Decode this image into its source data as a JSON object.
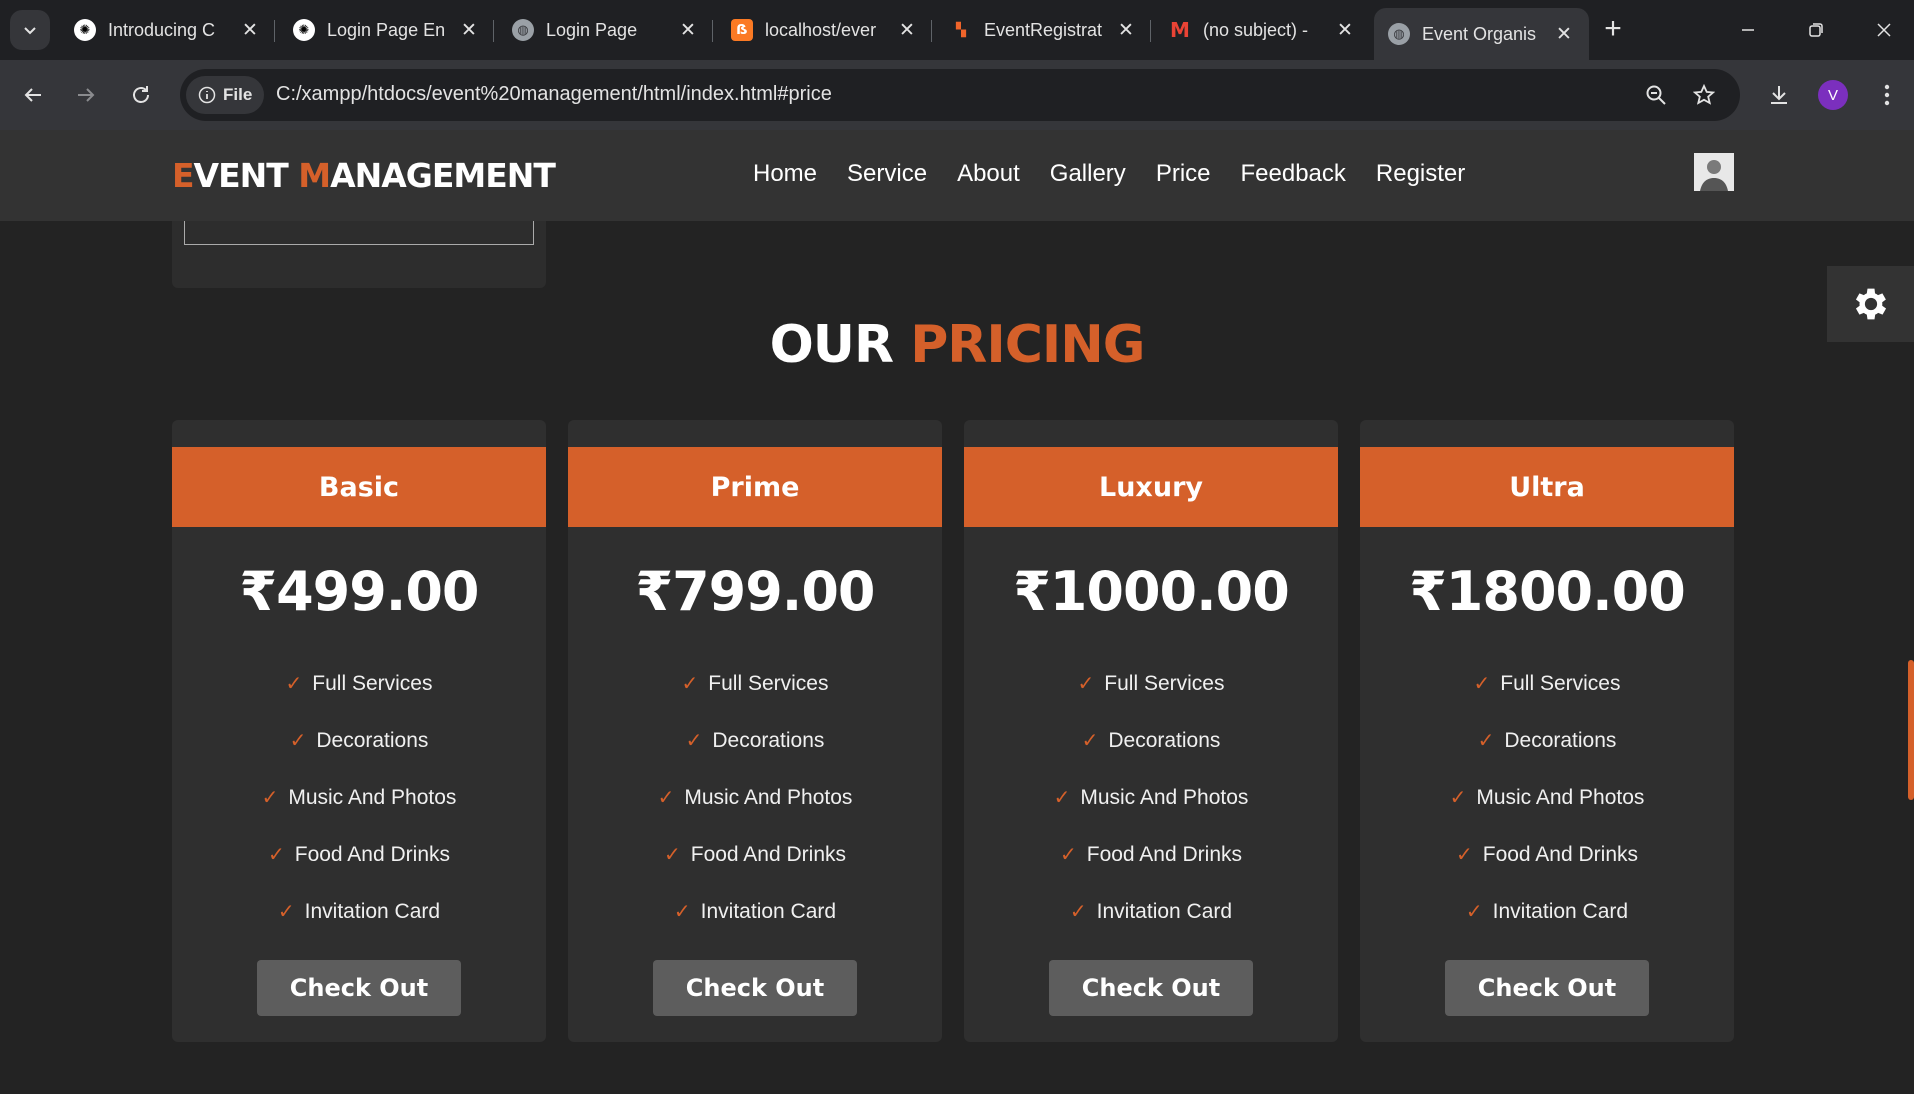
{
  "browser": {
    "tabs": [
      {
        "title": "Introducing C",
        "favicon": "openai-icon"
      },
      {
        "title": "Login Page En",
        "favicon": "openai-icon"
      },
      {
        "title": "Login Page",
        "favicon": "globe-icon"
      },
      {
        "title": "localhost/ever",
        "favicon": "xampp-icon"
      },
      {
        "title": "EventRegistrat",
        "favicon": "app-icon"
      },
      {
        "title": "(no subject) -",
        "favicon": "gmail-icon"
      },
      {
        "title": "Event Organis",
        "favicon": "globe-icon",
        "active": true
      }
    ],
    "address": {
      "chip": "File",
      "url": "C:/xampp/htdocs/event%20management/html/index.html#price"
    },
    "profile_initial": "V",
    "accent": "#7b2fbe"
  },
  "site": {
    "logo": {
      "first_initial": "E",
      "first_rest": "VENT ",
      "second_initial": "M",
      "second_rest": "ANAGEMENT"
    },
    "nav": [
      "Home",
      "Service",
      "About",
      "Gallery",
      "Price",
      "Feedback",
      "Register"
    ],
    "accent": "#d5602a"
  },
  "pricing": {
    "heading_plain": "OUR",
    "heading_accent": "PRICING",
    "plans": [
      {
        "name": "Basic",
        "price": "₹499.00",
        "button": "Check Out",
        "features": [
          "Full Services",
          "Decorations",
          "Music And Photos",
          "Food And Drinks",
          "Invitation Card"
        ]
      },
      {
        "name": "Prime",
        "price": "₹799.00",
        "button": "Check Out",
        "features": [
          "Full Services",
          "Decorations",
          "Music And Photos",
          "Food And Drinks",
          "Invitation Card"
        ]
      },
      {
        "name": "Luxury",
        "price": "₹1000.00",
        "button": "Check Out",
        "features": [
          "Full Services",
          "Decorations",
          "Music And Photos",
          "Food And Drinks",
          "Invitation Card"
        ]
      },
      {
        "name": "Ultra",
        "price": "₹1800.00",
        "button": "Check Out",
        "features": [
          "Full Services",
          "Decorations",
          "Music And Photos",
          "Food And Drinks",
          "Invitation Card"
        ]
      }
    ]
  }
}
